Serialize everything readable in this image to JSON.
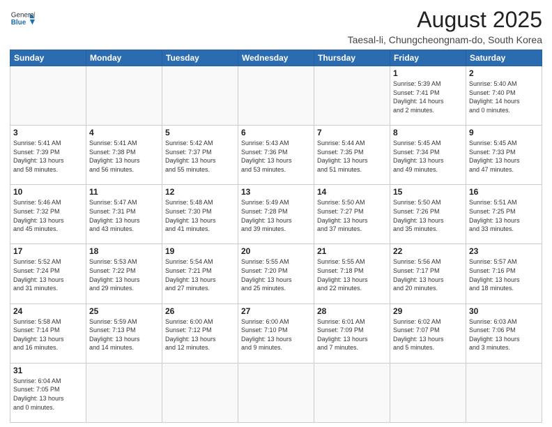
{
  "header": {
    "logo_general": "General",
    "logo_blue": "Blue",
    "title": "August 2025",
    "subtitle": "Taesal-li, Chungcheongnam-do, South Korea"
  },
  "days_of_week": [
    "Sunday",
    "Monday",
    "Tuesday",
    "Wednesday",
    "Thursday",
    "Friday",
    "Saturday"
  ],
  "weeks": [
    [
      {
        "day": "",
        "info": ""
      },
      {
        "day": "",
        "info": ""
      },
      {
        "day": "",
        "info": ""
      },
      {
        "day": "",
        "info": ""
      },
      {
        "day": "",
        "info": ""
      },
      {
        "day": "1",
        "info": "Sunrise: 5:39 AM\nSunset: 7:41 PM\nDaylight: 14 hours\nand 2 minutes."
      },
      {
        "day": "2",
        "info": "Sunrise: 5:40 AM\nSunset: 7:40 PM\nDaylight: 14 hours\nand 0 minutes."
      }
    ],
    [
      {
        "day": "3",
        "info": "Sunrise: 5:41 AM\nSunset: 7:39 PM\nDaylight: 13 hours\nand 58 minutes."
      },
      {
        "day": "4",
        "info": "Sunrise: 5:41 AM\nSunset: 7:38 PM\nDaylight: 13 hours\nand 56 minutes."
      },
      {
        "day": "5",
        "info": "Sunrise: 5:42 AM\nSunset: 7:37 PM\nDaylight: 13 hours\nand 55 minutes."
      },
      {
        "day": "6",
        "info": "Sunrise: 5:43 AM\nSunset: 7:36 PM\nDaylight: 13 hours\nand 53 minutes."
      },
      {
        "day": "7",
        "info": "Sunrise: 5:44 AM\nSunset: 7:35 PM\nDaylight: 13 hours\nand 51 minutes."
      },
      {
        "day": "8",
        "info": "Sunrise: 5:45 AM\nSunset: 7:34 PM\nDaylight: 13 hours\nand 49 minutes."
      },
      {
        "day": "9",
        "info": "Sunrise: 5:45 AM\nSunset: 7:33 PM\nDaylight: 13 hours\nand 47 minutes."
      }
    ],
    [
      {
        "day": "10",
        "info": "Sunrise: 5:46 AM\nSunset: 7:32 PM\nDaylight: 13 hours\nand 45 minutes."
      },
      {
        "day": "11",
        "info": "Sunrise: 5:47 AM\nSunset: 7:31 PM\nDaylight: 13 hours\nand 43 minutes."
      },
      {
        "day": "12",
        "info": "Sunrise: 5:48 AM\nSunset: 7:30 PM\nDaylight: 13 hours\nand 41 minutes."
      },
      {
        "day": "13",
        "info": "Sunrise: 5:49 AM\nSunset: 7:28 PM\nDaylight: 13 hours\nand 39 minutes."
      },
      {
        "day": "14",
        "info": "Sunrise: 5:50 AM\nSunset: 7:27 PM\nDaylight: 13 hours\nand 37 minutes."
      },
      {
        "day": "15",
        "info": "Sunrise: 5:50 AM\nSunset: 7:26 PM\nDaylight: 13 hours\nand 35 minutes."
      },
      {
        "day": "16",
        "info": "Sunrise: 5:51 AM\nSunset: 7:25 PM\nDaylight: 13 hours\nand 33 minutes."
      }
    ],
    [
      {
        "day": "17",
        "info": "Sunrise: 5:52 AM\nSunset: 7:24 PM\nDaylight: 13 hours\nand 31 minutes."
      },
      {
        "day": "18",
        "info": "Sunrise: 5:53 AM\nSunset: 7:22 PM\nDaylight: 13 hours\nand 29 minutes."
      },
      {
        "day": "19",
        "info": "Sunrise: 5:54 AM\nSunset: 7:21 PM\nDaylight: 13 hours\nand 27 minutes."
      },
      {
        "day": "20",
        "info": "Sunrise: 5:55 AM\nSunset: 7:20 PM\nDaylight: 13 hours\nand 25 minutes."
      },
      {
        "day": "21",
        "info": "Sunrise: 5:55 AM\nSunset: 7:18 PM\nDaylight: 13 hours\nand 22 minutes."
      },
      {
        "day": "22",
        "info": "Sunrise: 5:56 AM\nSunset: 7:17 PM\nDaylight: 13 hours\nand 20 minutes."
      },
      {
        "day": "23",
        "info": "Sunrise: 5:57 AM\nSunset: 7:16 PM\nDaylight: 13 hours\nand 18 minutes."
      }
    ],
    [
      {
        "day": "24",
        "info": "Sunrise: 5:58 AM\nSunset: 7:14 PM\nDaylight: 13 hours\nand 16 minutes."
      },
      {
        "day": "25",
        "info": "Sunrise: 5:59 AM\nSunset: 7:13 PM\nDaylight: 13 hours\nand 14 minutes."
      },
      {
        "day": "26",
        "info": "Sunrise: 6:00 AM\nSunset: 7:12 PM\nDaylight: 13 hours\nand 12 minutes."
      },
      {
        "day": "27",
        "info": "Sunrise: 6:00 AM\nSunset: 7:10 PM\nDaylight: 13 hours\nand 9 minutes."
      },
      {
        "day": "28",
        "info": "Sunrise: 6:01 AM\nSunset: 7:09 PM\nDaylight: 13 hours\nand 7 minutes."
      },
      {
        "day": "29",
        "info": "Sunrise: 6:02 AM\nSunset: 7:07 PM\nDaylight: 13 hours\nand 5 minutes."
      },
      {
        "day": "30",
        "info": "Sunrise: 6:03 AM\nSunset: 7:06 PM\nDaylight: 13 hours\nand 3 minutes."
      }
    ],
    [
      {
        "day": "31",
        "info": "Sunrise: 6:04 AM\nSunset: 7:05 PM\nDaylight: 13 hours\nand 0 minutes."
      },
      {
        "day": "",
        "info": ""
      },
      {
        "day": "",
        "info": ""
      },
      {
        "day": "",
        "info": ""
      },
      {
        "day": "",
        "info": ""
      },
      {
        "day": "",
        "info": ""
      },
      {
        "day": "",
        "info": ""
      }
    ]
  ]
}
